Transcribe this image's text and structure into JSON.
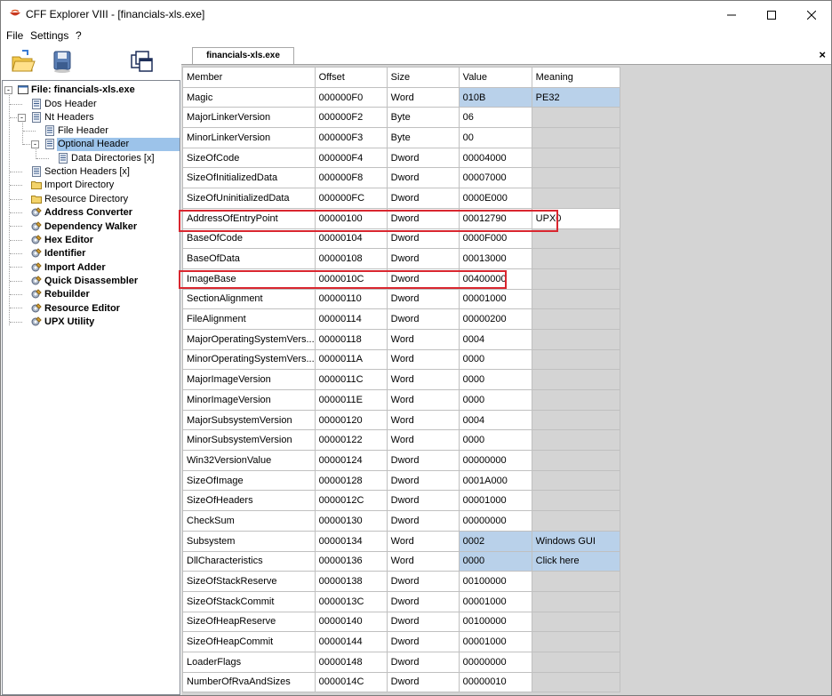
{
  "window": {
    "title": "CFF Explorer VIII - [financials-xls.exe]"
  },
  "menu": [
    "File",
    "Settings",
    "?"
  ],
  "toolbar": [
    {
      "icon": "open-folder-icon"
    },
    {
      "icon": "save-disk-icon"
    },
    {
      "icon": "windows-icon"
    }
  ],
  "tree": [
    {
      "label": "File: financials-xls.exe",
      "icon": "file-window-icon",
      "bold": true,
      "expander": "-"
    },
    {
      "label": "Dos Header",
      "icon": "list-icon"
    },
    {
      "label": "Nt Headers",
      "icon": "list-icon",
      "expander": "-"
    },
    {
      "label": "File Header",
      "icon": "list-icon"
    },
    {
      "label": "Optional Header",
      "icon": "list-icon",
      "expander": "-",
      "selected": true
    },
    {
      "label": "Data Directories [x]",
      "icon": "list-icon"
    },
    {
      "label": "Section Headers [x]",
      "icon": "list-icon"
    },
    {
      "label": "Import Directory",
      "icon": "folder-icon"
    },
    {
      "label": "Resource Directory",
      "icon": "folder-icon"
    },
    {
      "label": "Address Converter",
      "icon": "tool-icon",
      "bold": true
    },
    {
      "label": "Dependency Walker",
      "icon": "tool-icon",
      "bold": true
    },
    {
      "label": "Hex Editor",
      "icon": "tool-icon",
      "bold": true
    },
    {
      "label": "Identifier",
      "icon": "tool-icon",
      "bold": true
    },
    {
      "label": "Import Adder",
      "icon": "tool-icon",
      "bold": true
    },
    {
      "label": "Quick Disassembler",
      "icon": "tool-icon",
      "bold": true
    },
    {
      "label": "Rebuilder",
      "icon": "tool-icon",
      "bold": true
    },
    {
      "label": "Resource Editor",
      "icon": "tool-icon",
      "bold": true
    },
    {
      "label": "UPX Utility",
      "icon": "tool-icon",
      "bold": true
    }
  ],
  "tab": {
    "label": "financials-xls.exe",
    "close": "×"
  },
  "table": {
    "columns": [
      "Member",
      "Offset",
      "Size",
      "Value",
      "Meaning"
    ],
    "rows": [
      [
        "Magic",
        "000000F0",
        "Word",
        "010B",
        "PE32"
      ],
      [
        "MajorLinkerVersion",
        "000000F2",
        "Byte",
        "06",
        ""
      ],
      [
        "MinorLinkerVersion",
        "000000F3",
        "Byte",
        "00",
        ""
      ],
      [
        "SizeOfCode",
        "000000F4",
        "Dword",
        "00004000",
        ""
      ],
      [
        "SizeOfInitializedData",
        "000000F8",
        "Dword",
        "00007000",
        ""
      ],
      [
        "SizeOfUninitializedData",
        "000000FC",
        "Dword",
        "0000E000",
        ""
      ],
      [
        "AddressOfEntryPoint",
        "00000100",
        "Dword",
        "00012790",
        "UPX0"
      ],
      [
        "BaseOfCode",
        "00000104",
        "Dword",
        "0000F000",
        ""
      ],
      [
        "BaseOfData",
        "00000108",
        "Dword",
        "00013000",
        ""
      ],
      [
        "ImageBase",
        "0000010C",
        "Dword",
        "00400000",
        ""
      ],
      [
        "SectionAlignment",
        "00000110",
        "Dword",
        "00001000",
        ""
      ],
      [
        "FileAlignment",
        "00000114",
        "Dword",
        "00000200",
        ""
      ],
      [
        "MajorOperatingSystemVers...",
        "00000118",
        "Word",
        "0004",
        ""
      ],
      [
        "MinorOperatingSystemVers...",
        "0000011A",
        "Word",
        "0000",
        ""
      ],
      [
        "MajorImageVersion",
        "0000011C",
        "Word",
        "0000",
        ""
      ],
      [
        "MinorImageVersion",
        "0000011E",
        "Word",
        "0000",
        ""
      ],
      [
        "MajorSubsystemVersion",
        "00000120",
        "Word",
        "0004",
        ""
      ],
      [
        "MinorSubsystemVersion",
        "00000122",
        "Word",
        "0000",
        ""
      ],
      [
        "Win32VersionValue",
        "00000124",
        "Dword",
        "00000000",
        ""
      ],
      [
        "SizeOfImage",
        "00000128",
        "Dword",
        "0001A000",
        ""
      ],
      [
        "SizeOfHeaders",
        "0000012C",
        "Dword",
        "00001000",
        ""
      ],
      [
        "CheckSum",
        "00000130",
        "Dword",
        "00000000",
        ""
      ],
      [
        "Subsystem",
        "00000134",
        "Word",
        "0002",
        "Windows GUI"
      ],
      [
        "DllCharacteristics",
        "00000136",
        "Word",
        "0000",
        "Click here"
      ],
      [
        "SizeOfStackReserve",
        "00000138",
        "Dword",
        "00100000",
        ""
      ],
      [
        "SizeOfStackCommit",
        "0000013C",
        "Dword",
        "00001000",
        ""
      ],
      [
        "SizeOfHeapReserve",
        "00000140",
        "Dword",
        "00100000",
        ""
      ],
      [
        "SizeOfHeapCommit",
        "00000144",
        "Dword",
        "00001000",
        ""
      ],
      [
        "LoaderFlags",
        "00000148",
        "Dword",
        "00000000",
        ""
      ],
      [
        "NumberOfRvaAndSizes",
        "0000014C",
        "Dword",
        "00000010",
        ""
      ]
    ],
    "highlight_value_meaning_rows": [
      0,
      22,
      23
    ],
    "highlight_color": "#b9d1ea",
    "annotation_color": "#d9262f"
  }
}
